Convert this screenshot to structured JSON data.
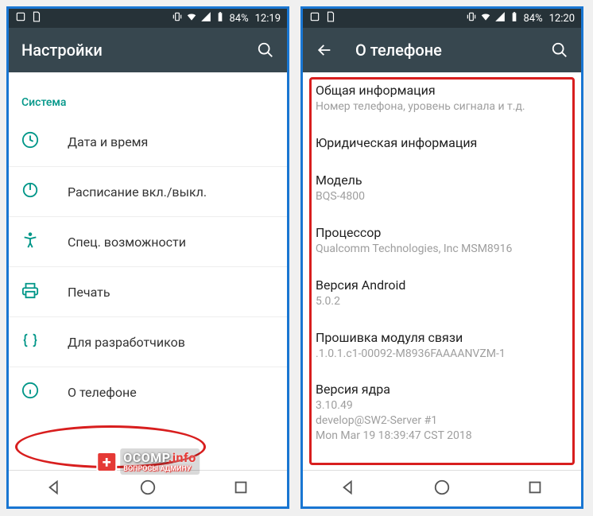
{
  "screen1": {
    "status": {
      "battery": "84%",
      "time": "12:19"
    },
    "appbar": {
      "title": "Настройки"
    },
    "section_header": "Система",
    "items": [
      {
        "label": "Дата и время"
      },
      {
        "label": "Расписание вкл./выкл."
      },
      {
        "label": "Спец. возможности"
      },
      {
        "label": "Печать"
      },
      {
        "label": "Для разработчиков"
      },
      {
        "label": "О телефоне"
      }
    ]
  },
  "screen2": {
    "status": {
      "battery": "84%",
      "time": "12:20"
    },
    "appbar": {
      "title": "О телефоне"
    },
    "items": [
      {
        "title": "Общая информация",
        "sub": "Номер телефона, уровень сигнала и т.д."
      },
      {
        "title": "Юридическая информация",
        "sub": ""
      },
      {
        "title": "Модель",
        "sub": "BQS-4800"
      },
      {
        "title": "Процессор",
        "sub": "Qualcomm Technologies, Inc MSM8916"
      },
      {
        "title": "Версия Android",
        "sub": "5.0.2"
      },
      {
        "title": "Прошивка модуля связи",
        "sub": ".1.0.1.c1-00092-M8936FAAAANVZM-1"
      },
      {
        "title": "Версия ядра",
        "sub": "3.10.49\ndevelop@SW2-Server #1\nMon Mar 19 18:39:47 CST 2018"
      }
    ]
  },
  "watermark": {
    "main": "OCOMP",
    "suffix": ".info",
    "sub": "ВОПРОСЫ АДМИНУ"
  }
}
